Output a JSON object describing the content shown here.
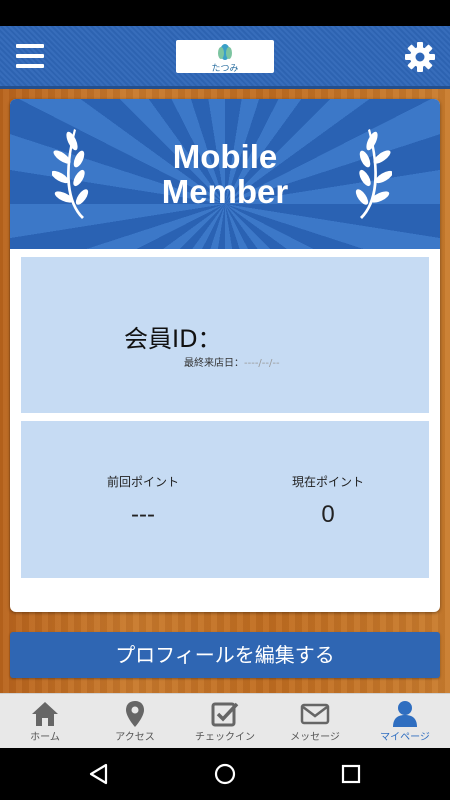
{
  "header": {
    "logo_text": "たつみ",
    "colors": {
      "bar": "#2f67b8",
      "bar_border": "#244f8d"
    },
    "menu_icon": "hamburger-menu-icon",
    "settings_icon": "gear-icon"
  },
  "card": {
    "banner": {
      "title_line1": "Mobile",
      "title_line2": "Member"
    },
    "member": {
      "id_label": "会員ID：",
      "last_visit_label": "最終来店日：",
      "last_visit_value": "----/--/--"
    },
    "points": {
      "previous_label": "前回ポイント",
      "previous_value": "---",
      "current_label": "現在ポイント",
      "current_value": "0"
    }
  },
  "edit_button": {
    "label": "プロフィールを編集する"
  },
  "tabs": [
    {
      "label": "ホーム",
      "icon": "home-icon",
      "active": false
    },
    {
      "label": "アクセス",
      "icon": "map-pin-icon",
      "active": false
    },
    {
      "label": "チェックイン",
      "icon": "checkbox-icon",
      "active": false
    },
    {
      "label": "メッセージ",
      "icon": "envelope-icon",
      "active": false
    },
    {
      "label": "マイページ",
      "icon": "person-icon",
      "active": true
    }
  ],
  "colors": {
    "accent": "#2f66b3",
    "panel": "#c6dbf3",
    "active_tab": "#2f6ec0"
  }
}
